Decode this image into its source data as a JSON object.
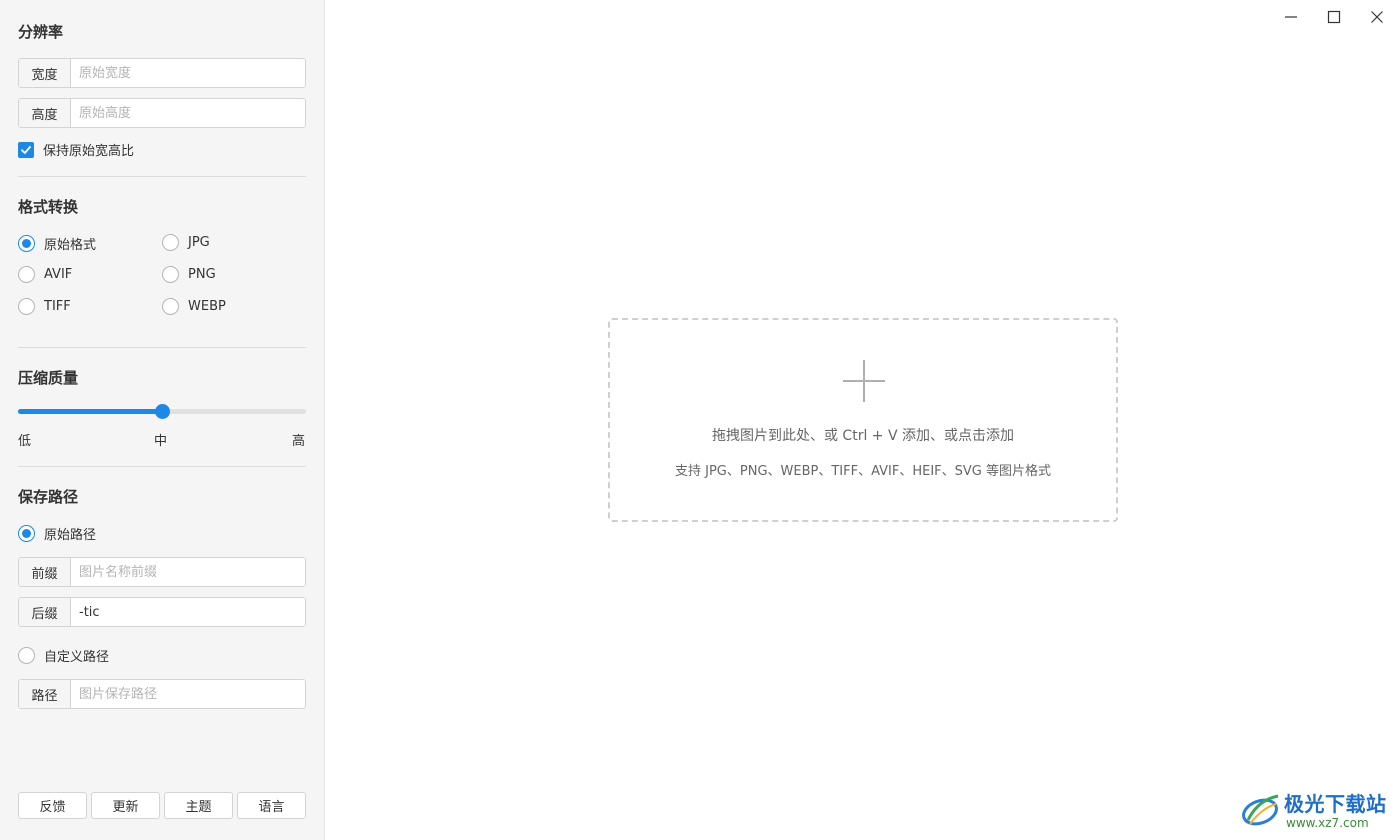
{
  "sidebar": {
    "resolution": {
      "title": "分辨率",
      "width_label": "宽度",
      "width_placeholder": "原始宽度",
      "height_label": "高度",
      "height_placeholder": "原始高度",
      "keep_ratio_label": "保持原始宽高比",
      "keep_ratio_checked": true
    },
    "format": {
      "title": "格式转换",
      "options": [
        "原始格式",
        "JPG",
        "AVIF",
        "PNG",
        "TIFF",
        "WEBP"
      ],
      "selected": "原始格式"
    },
    "quality": {
      "title": "压缩质量",
      "value": 0.5,
      "low_label": "低",
      "mid_label": "中",
      "high_label": "高"
    },
    "save_path": {
      "title": "保存路径",
      "original_path_label": "原始路径",
      "original_path_selected": true,
      "prefix_label": "前缀",
      "prefix_placeholder": "图片名称前缀",
      "suffix_label": "后缀",
      "suffix_value": "-tic",
      "custom_path_label": "自定义路径",
      "custom_path_selected": false,
      "path_label": "路径",
      "path_placeholder": "图片保存路径"
    },
    "footer": {
      "feedback": "反馈",
      "update": "更新",
      "theme": "主题",
      "language": "语言"
    }
  },
  "window_controls": {
    "minimize_icon": "minimize-icon",
    "maximize_icon": "maximize-icon",
    "close_icon": "close-icon"
  },
  "dropzone": {
    "icon": "plus-icon",
    "line1": "拖拽图片到此处、或 Ctrl + V 添加、或点击添加",
    "line2": "支持 JPG、PNG、WEBP、TIFF、AVIF、HEIF、SVG 等图片格式"
  },
  "watermark": {
    "title": "极光下载站",
    "url": "www.xz7.com"
  },
  "colors": {
    "accent": "#1e88e5",
    "sidebar_bg": "#f5f5f5"
  }
}
